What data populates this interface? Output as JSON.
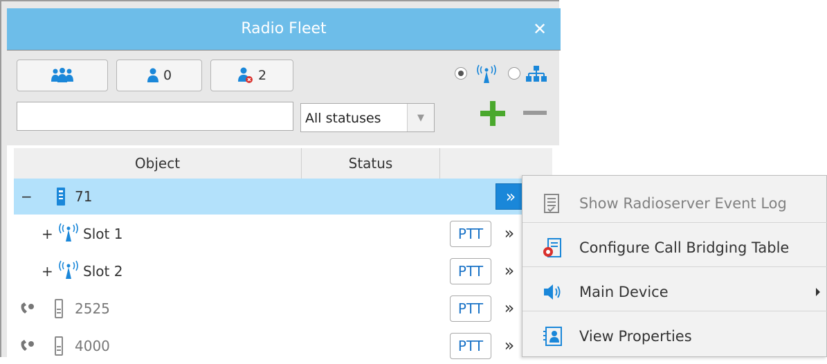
{
  "window": {
    "title": "Radio Fleet",
    "close_glyph": "✕"
  },
  "toolbar": {
    "groups_icon": "group-icon",
    "online_count": "0",
    "offline_count": "2",
    "view_mode": "radio-network"
  },
  "filter": {
    "search_value": "",
    "status_selected": "All statuses"
  },
  "table": {
    "columns": [
      "Object",
      "Status",
      ""
    ],
    "rows": [
      {
        "expander": "−",
        "label": "71",
        "kind": "radioserver",
        "selected": true
      },
      {
        "expander": "+",
        "label": "Slot 1",
        "kind": "slot",
        "ptt": "PTT"
      },
      {
        "expander": "+",
        "label": "Slot 2",
        "kind": "slot",
        "ptt": "PTT"
      },
      {
        "label": "2525",
        "kind": "radio",
        "ptt": "PTT"
      },
      {
        "label": "4000",
        "kind": "radio",
        "ptt": "PTT"
      }
    ],
    "more_glyph": "»"
  },
  "context_menu": {
    "items": [
      {
        "label": "Show Radioserver Event Log",
        "icon": "event-log-icon",
        "disabled": true
      },
      {
        "label": "Configure Call Bridging Table",
        "icon": "call-bridging-icon",
        "disabled": false
      },
      {
        "label": "Main Device",
        "icon": "speaker-icon",
        "disabled": false,
        "submenu": true
      },
      {
        "label": "View Properties",
        "icon": "properties-icon",
        "disabled": false
      }
    ]
  },
  "colors": {
    "titlebar": "#6dbde9",
    "selected_row": "#b3e1fb",
    "accent_blue": "#1a87d9",
    "add_green": "#4aa82d"
  }
}
